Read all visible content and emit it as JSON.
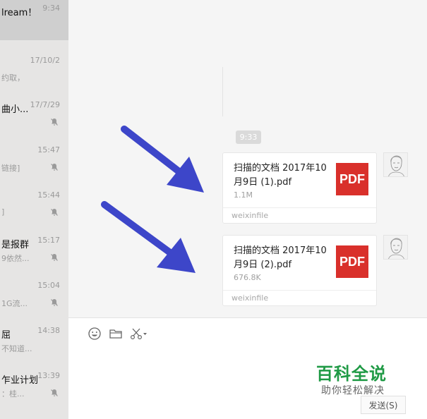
{
  "sidebar": {
    "chats": [
      {
        "name": "lream！",
        "time": "9:34",
        "preview": "",
        "muted": false,
        "active": true
      },
      {
        "name": "",
        "time": "17/10/2",
        "preview": "约取，",
        "muted": false,
        "active": false
      },
      {
        "name": "曲小...",
        "time": "17/7/29",
        "preview": "",
        "muted": true,
        "active": false
      },
      {
        "name": "",
        "time": "15:47",
        "preview": "链接]",
        "muted": true,
        "active": false
      },
      {
        "name": "",
        "time": "15:44",
        "preview": "]",
        "muted": true,
        "active": false
      },
      {
        "name": "是报群",
        "time": "15:17",
        "preview": "9依然...",
        "muted": true,
        "active": false
      },
      {
        "name": "",
        "time": "15:04",
        "preview": "1G流...",
        "muted": true,
        "active": false
      },
      {
        "name": "屈",
        "time": "14:38",
        "preview": "不知道...",
        "muted": false,
        "active": false
      },
      {
        "name": "乍业计划",
        "time": "13:39",
        "preview": "：桂...",
        "muted": true,
        "active": false
      }
    ]
  },
  "chat": {
    "time_separator": "9:33",
    "messages": [
      {
        "filename": "扫描的文档 2017年10月9日 (1).pdf",
        "size": "1.1M",
        "source": "weixinfile",
        "icon_label": "PDF"
      },
      {
        "filename": "扫描的文档 2017年10月9日 (2).pdf",
        "size": "676.8K",
        "source": "weixinfile",
        "icon_label": "PDF"
      }
    ]
  },
  "input": {
    "tools": [
      "emoji-icon",
      "folder-icon",
      "scissors-icon"
    ],
    "send_label": "发送(S)"
  },
  "watermark": {
    "title": "百科全说",
    "subtitle": "助你轻松解决"
  },
  "colors": {
    "arrow": "#3d46c9",
    "pdf": "#d9302b",
    "watermark": "#1f9a45"
  }
}
